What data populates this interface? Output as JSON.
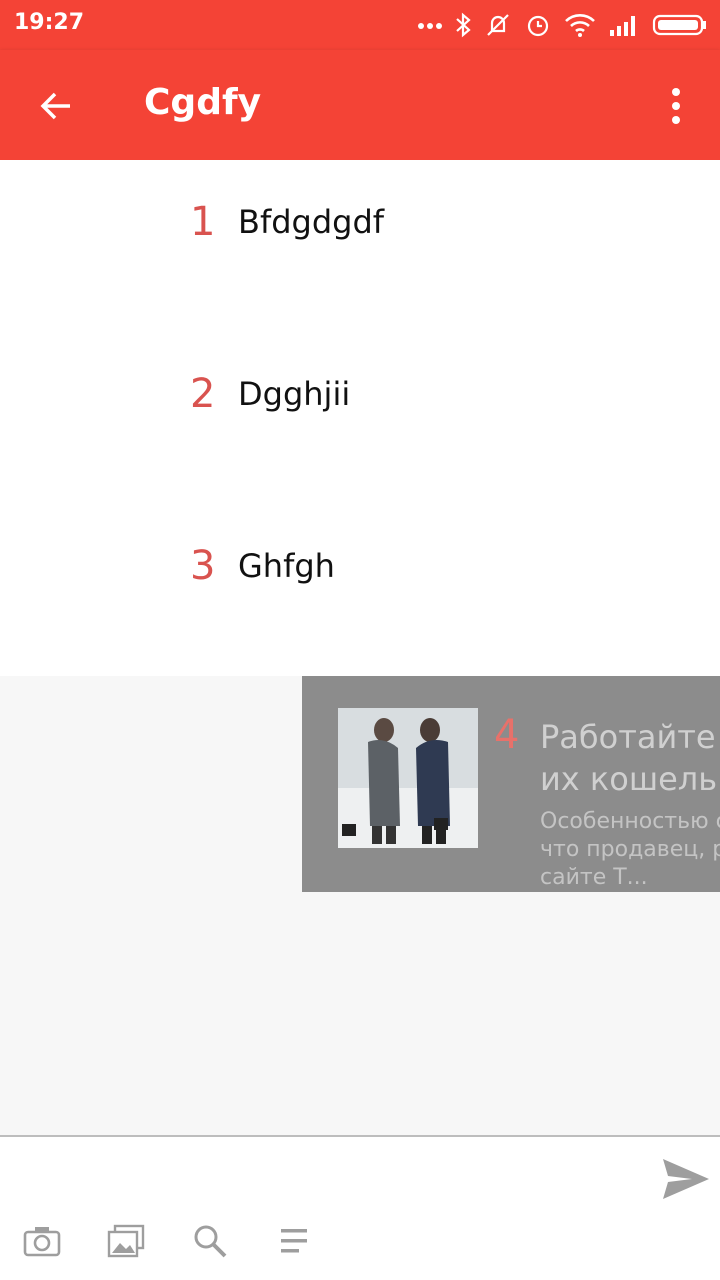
{
  "status_bar": {
    "time": "19:27",
    "icons": [
      "dots-icon",
      "bluetooth-icon",
      "silent-icon",
      "alarm-icon",
      "wifi-icon",
      "signal-icon",
      "battery-icon"
    ]
  },
  "app_bar": {
    "title": "Cgdfy",
    "back_icon": "arrow-back-icon",
    "menu_icon": "more-vert-icon"
  },
  "items": [
    {
      "number": "1",
      "text": "Bfdgdgdf"
    },
    {
      "number": "2",
      "text": "Dgghjii"
    },
    {
      "number": "3",
      "text": "Ghfgh"
    }
  ],
  "card": {
    "number": "4",
    "title_line1": "Работайте",
    "title_line2": "их кошельк",
    "desc_line1": "Особенностью с",
    "desc_line2": "что продавец, ра",
    "desc_line3": "сайте Т..."
  },
  "input_bar": {
    "send_icon": "send-icon",
    "tools": [
      "camera-icon",
      "gallery-icon",
      "search-icon",
      "text-lines-icon"
    ]
  },
  "colors": {
    "accent": "#f44336",
    "number": "#d9534f"
  }
}
